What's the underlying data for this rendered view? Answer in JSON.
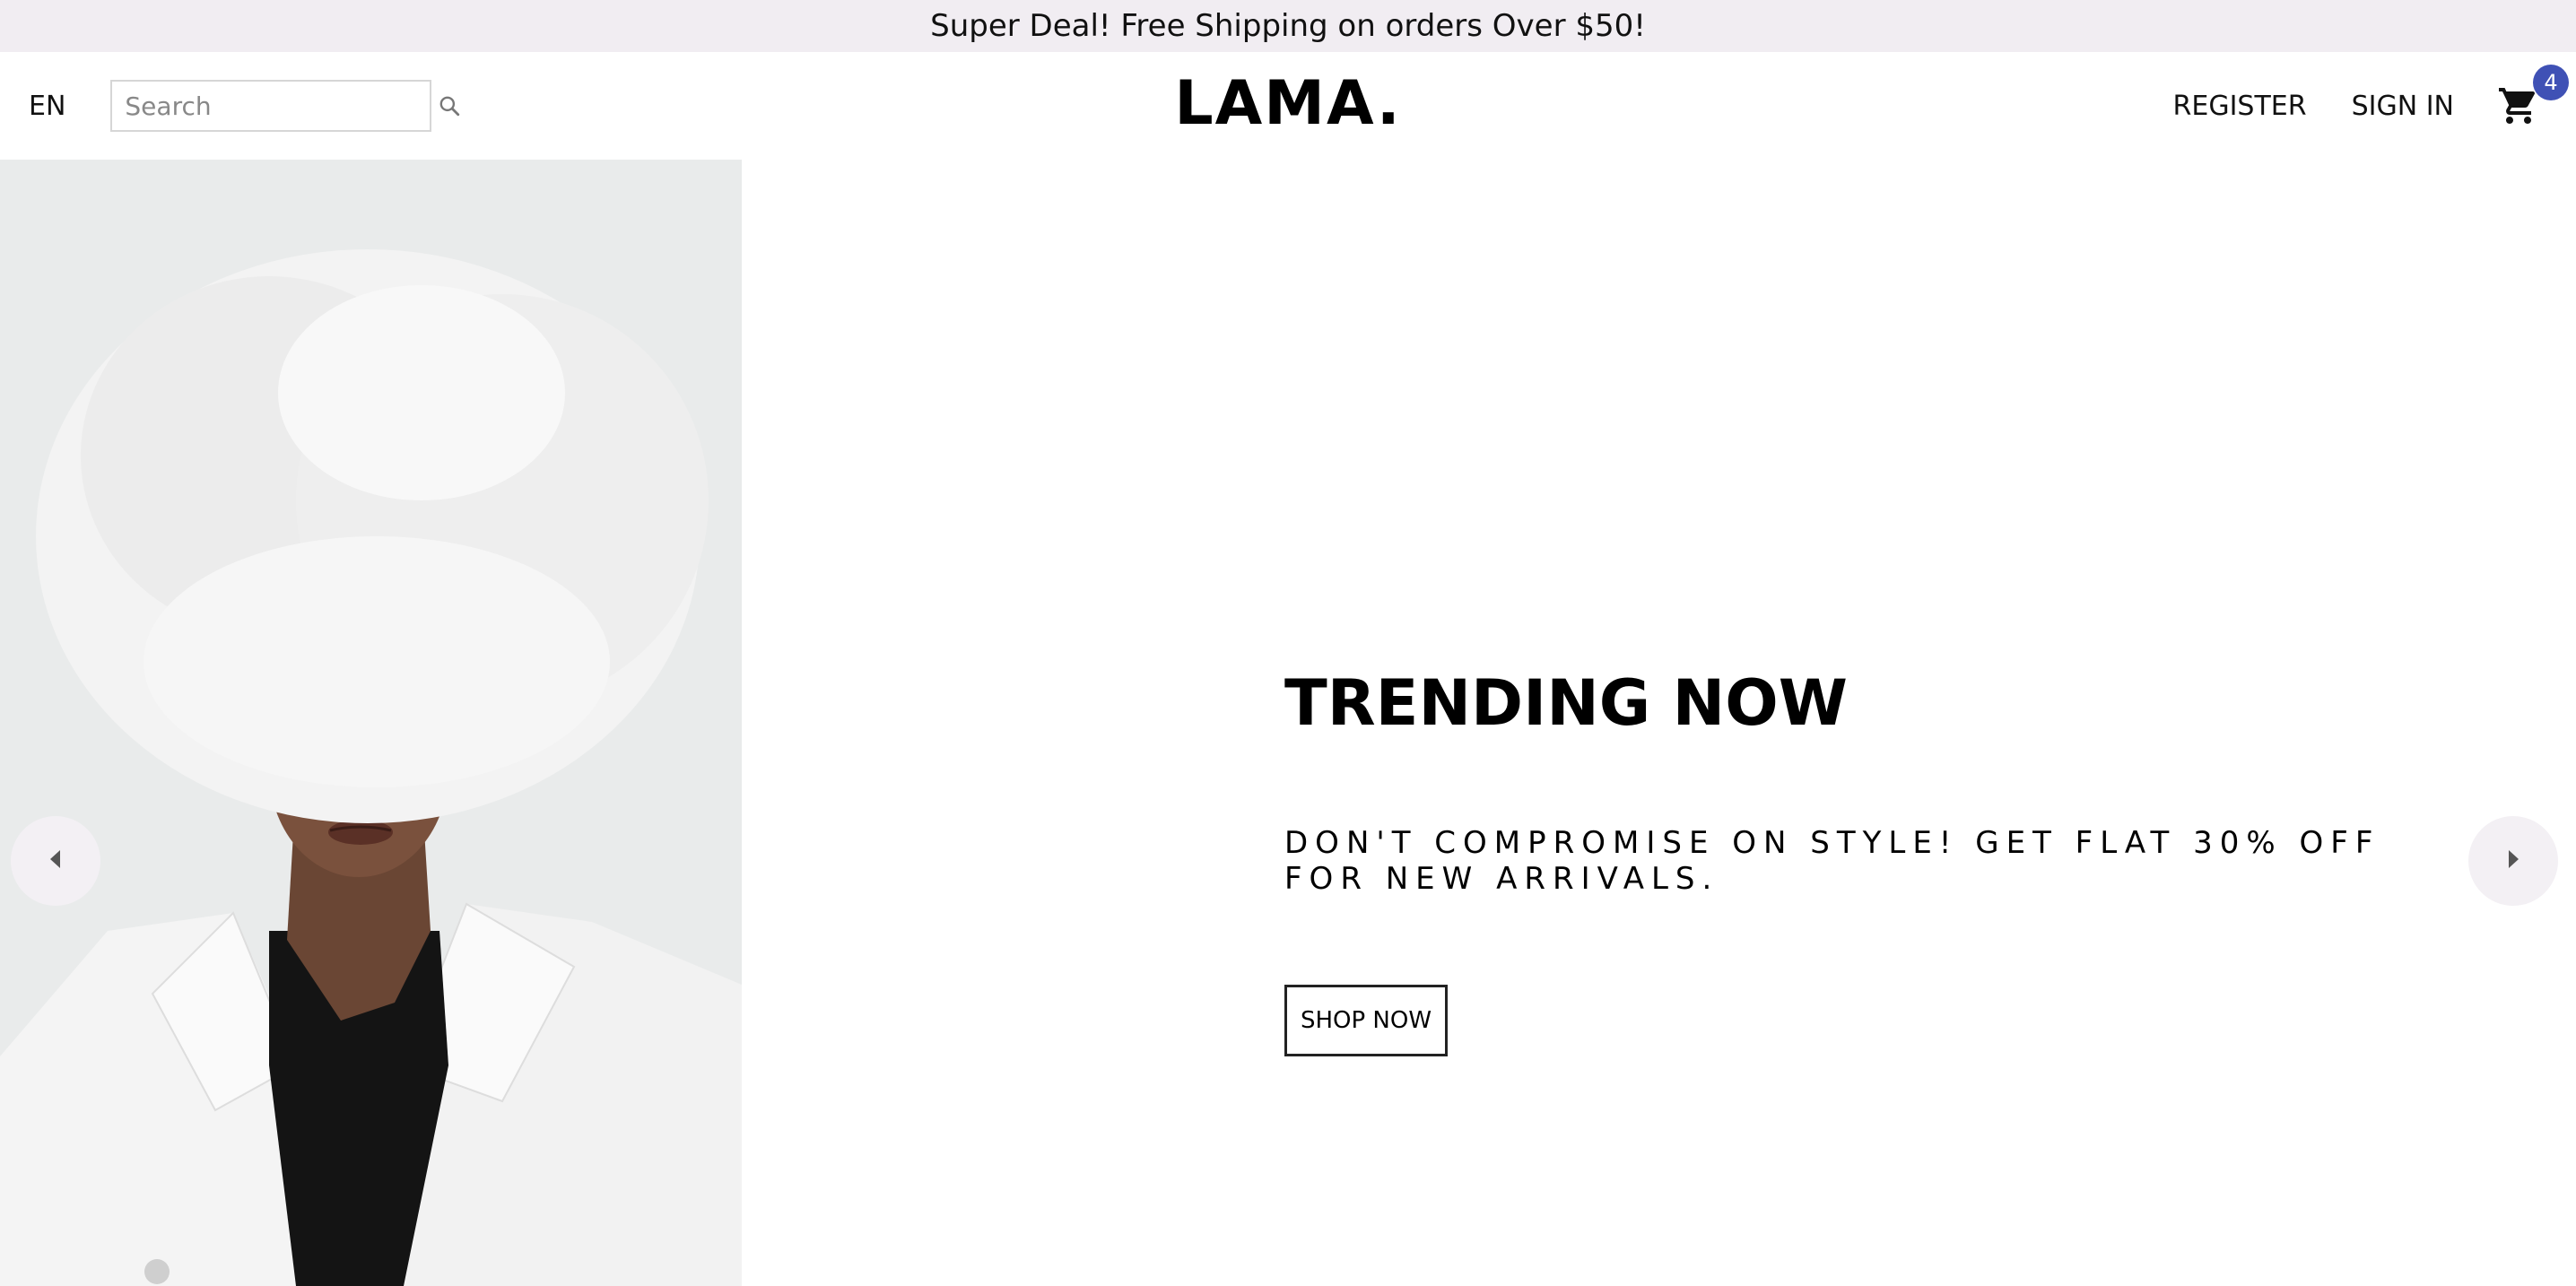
{
  "announcement": {
    "text": "Super Deal! Free Shipping on orders Over $50!"
  },
  "navbar": {
    "language": "EN",
    "search": {
      "placeholder": "Search",
      "value": "",
      "icon": "search-icon"
    },
    "logo": "LAMA.",
    "links": {
      "register": "REGISTER",
      "sign_in": "SIGN IN"
    },
    "cart": {
      "icon": "shopping-cart-icon",
      "badge_count": "4"
    }
  },
  "slider": {
    "title": "TRENDING NOW",
    "description": "DON'T COMPROMISE ON STYLE! GET FLAT 30% OFF FOR NEW ARRIVALS.",
    "button_label": "SHOP NOW",
    "left_arrow_icon": "arrow-left-icon",
    "right_arrow_icon": "arrow-right-icon"
  },
  "colors": {
    "announcement_bg": "#f1edf2",
    "badge": "#3f51b5",
    "arrow_bg": "#f3f0f4"
  }
}
